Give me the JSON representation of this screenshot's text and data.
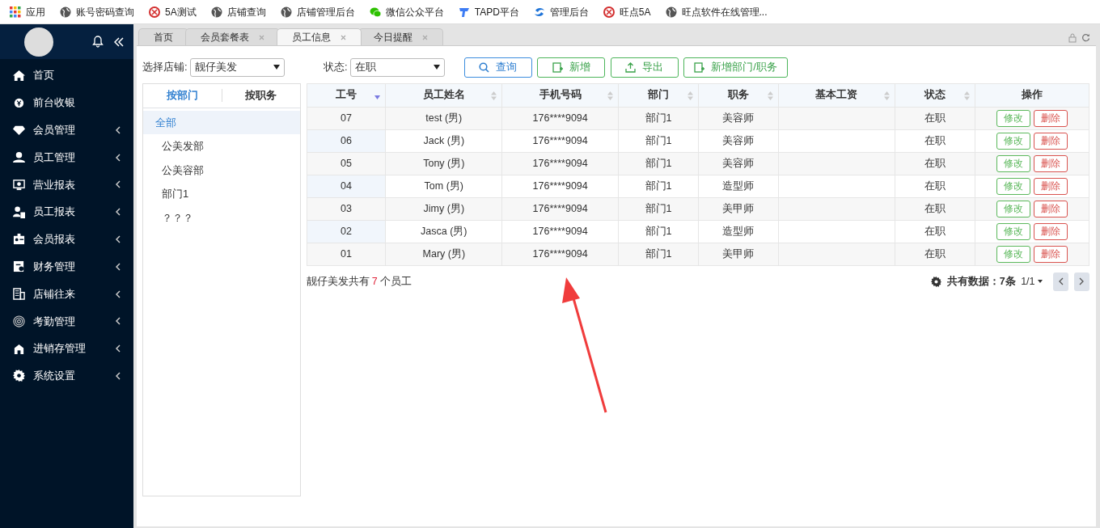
{
  "bookmarks": [
    {
      "kind": "grid",
      "label": "应用"
    },
    {
      "kind": "globe",
      "label": "账号密码查询"
    },
    {
      "kind": "ring",
      "label": "5A测试"
    },
    {
      "kind": "globe",
      "label": "店铺查询"
    },
    {
      "kind": "globe",
      "label": "店铺管理后台"
    },
    {
      "kind": "chat",
      "label": "微信公众平台"
    },
    {
      "kind": "tapd",
      "label": "TAPD平台"
    },
    {
      "kind": "swirl",
      "label": "管理后台"
    },
    {
      "kind": "ring",
      "label": "旺点5A"
    },
    {
      "kind": "globe",
      "label": "旺点软件在线管理..."
    }
  ],
  "sidebar": {
    "items": [
      {
        "kind": "home",
        "label": "首页",
        "expandable": false
      },
      {
        "kind": "money",
        "label": "前台收银",
        "expandable": false
      },
      {
        "kind": "diamond",
        "label": "会员管理",
        "expandable": true
      },
      {
        "kind": "user",
        "label": "员工管理",
        "expandable": true
      },
      {
        "kind": "monitor",
        "label": "营业报表",
        "expandable": true
      },
      {
        "kind": "userdoc",
        "label": "员工报表",
        "expandable": true
      },
      {
        "kind": "card",
        "label": "会员报表",
        "expandable": true
      },
      {
        "kind": "ledger",
        "label": "财务管理",
        "expandable": true
      },
      {
        "kind": "building",
        "label": "店铺往来",
        "expandable": true
      },
      {
        "kind": "finger",
        "label": "考勤管理",
        "expandable": true
      },
      {
        "kind": "house",
        "label": "进销存管理",
        "expandable": true
      },
      {
        "kind": "gear",
        "label": "系统设置",
        "expandable": true
      }
    ]
  },
  "tabs": [
    {
      "label": "首页",
      "closable": false,
      "selected": false
    },
    {
      "label": "会员套餐表",
      "closable": true,
      "selected": false
    },
    {
      "label": "员工信息",
      "closable": true,
      "selected": true
    },
    {
      "label": "今日提醒",
      "closable": true,
      "selected": false
    }
  ],
  "filters": [
    {
      "label": "选择店铺:",
      "value": "靓仔美发"
    },
    {
      "label": "状态:",
      "value": "在职"
    }
  ],
  "buttons": [
    {
      "kind": "search",
      "label": "查询"
    },
    {
      "kind": "add",
      "label": "新增"
    },
    {
      "kind": "export",
      "label": "导出"
    },
    {
      "kind": "add",
      "label": "新增部门/职务"
    }
  ],
  "group_tabs": [
    {
      "label": "按部门",
      "selected": true
    },
    {
      "label": "按职务",
      "selected": false
    }
  ],
  "tree": [
    {
      "label": "全部",
      "selected": true,
      "children": [
        {
          "label": "公美发部",
          "selected": false
        },
        {
          "label": "公美容部",
          "selected": false
        },
        {
          "label": "部门1",
          "selected": false
        },
        {
          "label": "？？？",
          "selected": false
        }
      ]
    }
  ],
  "table": {
    "columns": [
      {
        "label": "工号",
        "kind": "sorted"
      },
      {
        "label": "员工姓名",
        "kind": "sortable"
      },
      {
        "label": "手机号码",
        "kind": "sortable"
      },
      {
        "label": "部门",
        "kind": "sortable"
      },
      {
        "label": "职务",
        "kind": "sortable"
      },
      {
        "label": "基本工资",
        "kind": "sortable"
      },
      {
        "label": "状态",
        "kind": "sortable"
      },
      {
        "label": "操作",
        "kind": "plain"
      }
    ],
    "rows": [
      {
        "cells": [
          "07",
          "test (男)",
          "176****9094",
          "部门1",
          "美容师",
          "在职"
        ],
        "actions": [
          "修改",
          "删除"
        ]
      },
      {
        "cells": [
          "06",
          "Jack (男)",
          "176****9094",
          "部门1",
          "美容师",
          "在职"
        ],
        "actions": [
          "修改",
          "删除"
        ]
      },
      {
        "cells": [
          "05",
          "Tony (男)",
          "176****9094",
          "部门1",
          "美容师",
          "在职"
        ],
        "actions": [
          "修改",
          "删除"
        ]
      },
      {
        "cells": [
          "04",
          "Tom (男)",
          "176****9094",
          "部门1",
          "造型师",
          "在职"
        ],
        "actions": [
          "修改",
          "删除"
        ]
      },
      {
        "cells": [
          "03",
          "Jimy (男)",
          "176****9094",
          "部门1",
          "美甲师",
          "在职"
        ],
        "actions": [
          "修改",
          "删除"
        ]
      },
      {
        "cells": [
          "02",
          "Jasca (男)",
          "176****9094",
          "部门1",
          "造型师",
          "在职"
        ],
        "actions": [
          "修改",
          "删除"
        ]
      },
      {
        "cells": [
          "01",
          "Mary (男)",
          "176****9094",
          "部门1",
          "美甲师",
          "在职"
        ],
        "actions": [
          "修改",
          "删除"
        ]
      }
    ]
  },
  "summary": {
    "before": "靓仔美发共有",
    "count": "7",
    "after": "个员工"
  },
  "pager": {
    "total": "共有数据：7条",
    "page": "1/1"
  }
}
